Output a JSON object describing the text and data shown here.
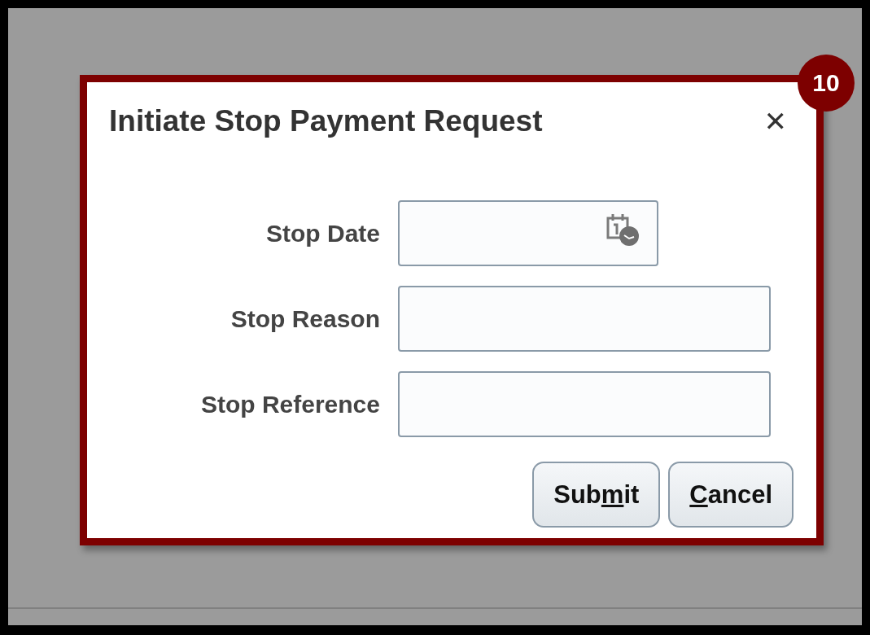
{
  "dialog": {
    "title": "Initiate Stop Payment Request",
    "close": "✕",
    "step_badge": "10",
    "fields": [
      {
        "kind": "date",
        "label": "Stop Date"
      },
      {
        "kind": "text",
        "label": "Stop Reason"
      },
      {
        "kind": "text",
        "label": "Stop Reference"
      }
    ],
    "buttons": [
      {
        "before": "Sub",
        "key": "m",
        "after": "it"
      },
      {
        "key": "C",
        "after": "ancel"
      }
    ]
  }
}
